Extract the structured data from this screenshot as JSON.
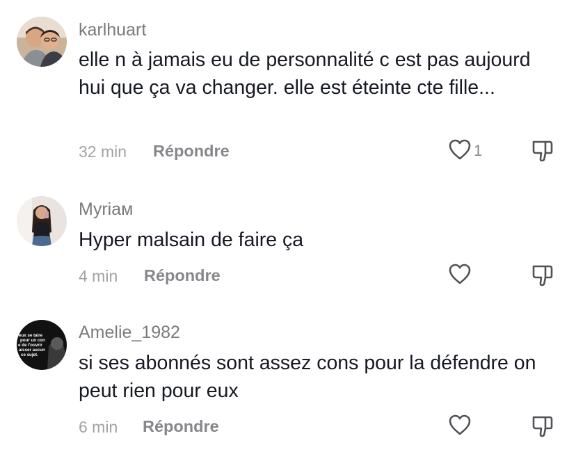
{
  "comments": [
    {
      "username": "karlhuart",
      "text": "elle n à jamais eu de personnalité c est pas aujourd hui que ça va changer. elle est éteinte cte fille...",
      "time": "32 min",
      "reply_label": "Répondre",
      "like_count": "1"
    },
    {
      "username": "Myriaм",
      "text": "Hyper malsain de faire ça",
      "time": "4 min",
      "reply_label": "Répondre",
      "like_count": ""
    },
    {
      "username": "Amelie_1982",
      "text": "si ses abonnés sont assez cons pour la défendre on peut rien pour eux",
      "time": "6 min",
      "reply_label": "Répondre",
      "like_count": ""
    }
  ],
  "avatar_3_quote": [
    "eux se taire",
    "pour un con",
    "e de l'ouvrir",
    "aisser aucun",
    "ce sujet."
  ],
  "colors": {
    "text": "#161823",
    "secondary": "#86868b",
    "time": "#a2a2a6",
    "username": "#7a7a7f"
  },
  "icons": [
    "heart-outline-icon",
    "thumbs-down-outline-icon"
  ]
}
